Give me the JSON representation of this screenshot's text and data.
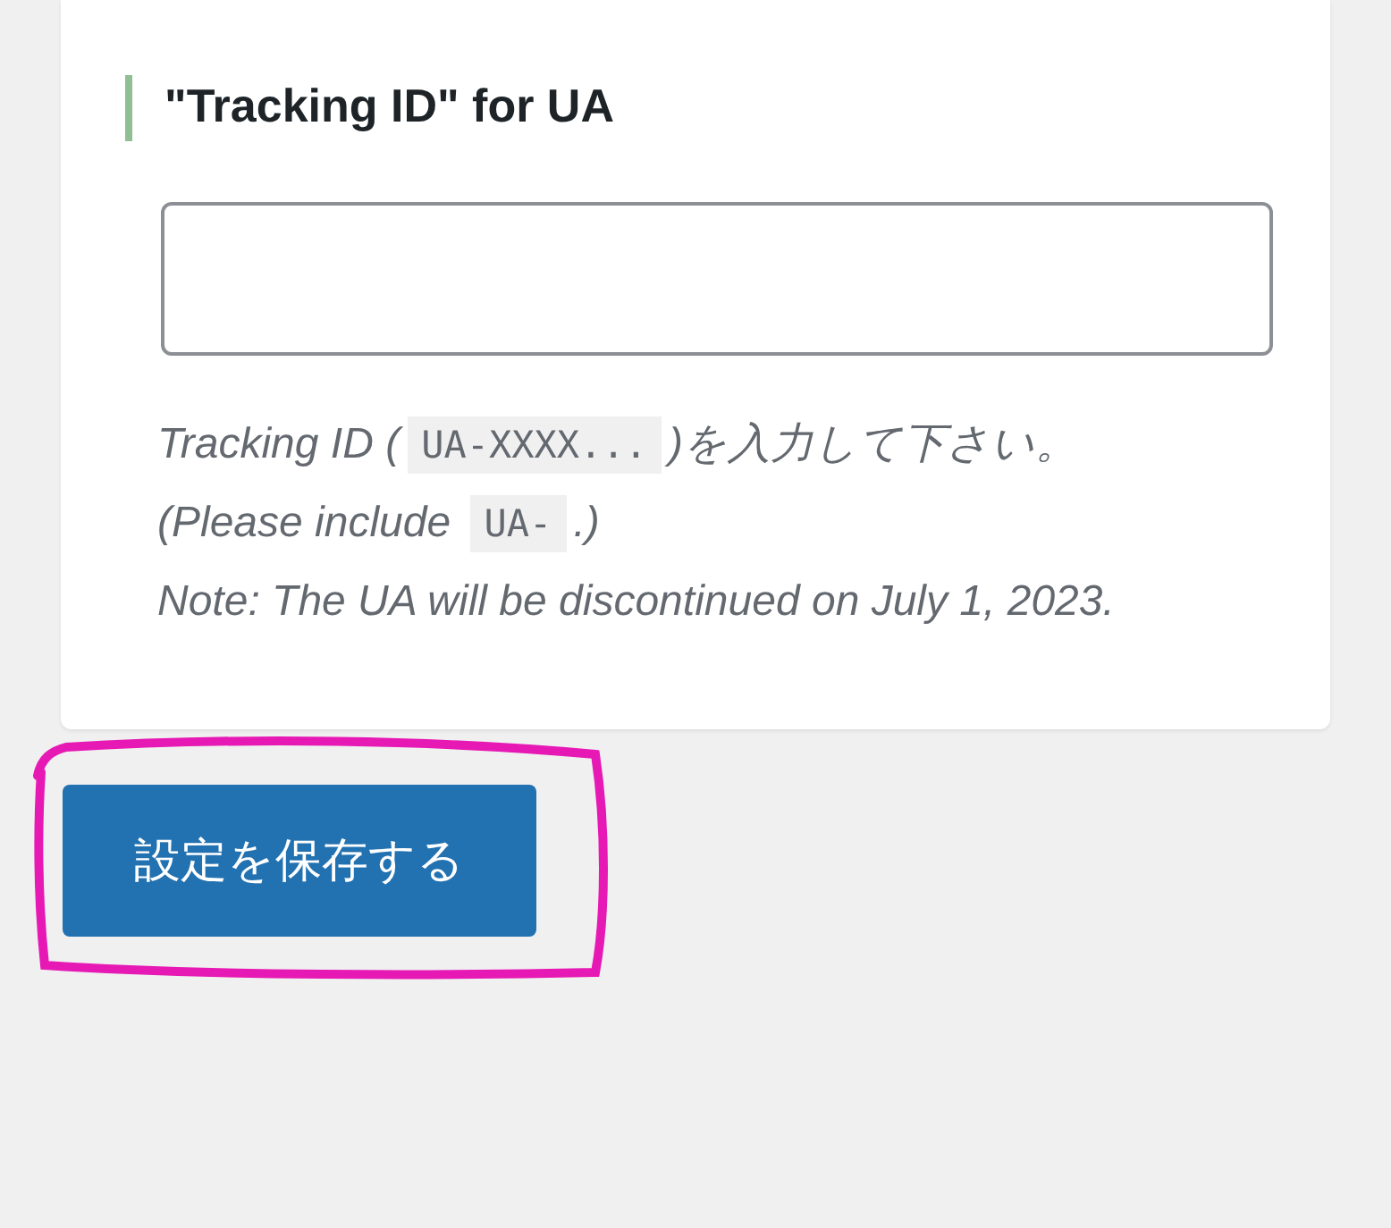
{
  "section": {
    "heading": "\"Tracking ID\" for UA"
  },
  "help_lines": [
    {
      "segments": [
        {
          "kind": "text",
          "text": "Tracking ID ("
        },
        {
          "kind": "code",
          "text": "UA-XXXX..."
        },
        {
          "kind": "text",
          "text": ")を入力して下さい。"
        }
      ]
    },
    {
      "segments": [
        {
          "kind": "text",
          "text": "(Please include "
        },
        {
          "kind": "code",
          "text": "UA-"
        },
        {
          "kind": "text",
          "text": ".)"
        }
      ]
    },
    {
      "segments": [
        {
          "kind": "text",
          "text": "Note: The UA will be discontinued on July 1, 2023."
        }
      ]
    }
  ],
  "save_button": {
    "label": "設定を保存する"
  }
}
